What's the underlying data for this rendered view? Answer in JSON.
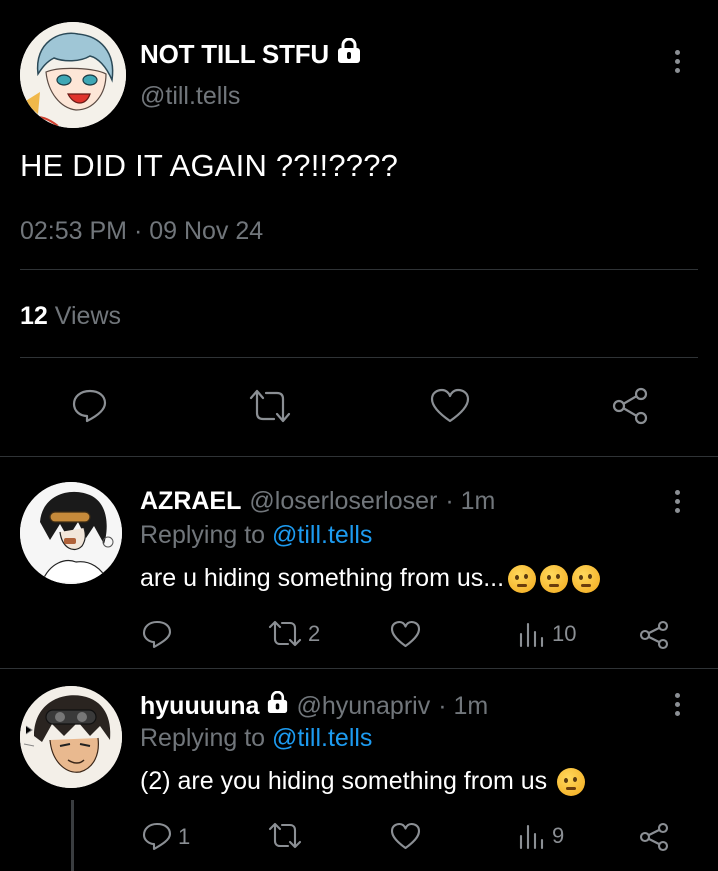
{
  "main_tweet": {
    "display_name": "NOT TILL STFU",
    "handle": "@till.tells",
    "text": "HE DID IT AGAIN ??!!????",
    "timestamp": "02:53 PM · 09 Nov 24",
    "views_count": "12",
    "views_label": "Views",
    "icons": [
      "lock-icon",
      "more-icon",
      "reply-icon",
      "retweet-icon",
      "like-icon",
      "share-icon"
    ]
  },
  "replies": [
    {
      "display_name": "AZRAEL",
      "handle": "@loserloserloser",
      "time": "· 1m",
      "replying_label": "Replying to",
      "replying_to": "@till.tells",
      "text": "are u hiding something from us...",
      "emoji_count": 3,
      "retweets": "2",
      "views": "10",
      "replies_count": "",
      "locked": false
    },
    {
      "display_name": "hyuuuuna",
      "handle": "@hyunapriv",
      "time": "· 1m",
      "replying_label": "Replying to",
      "replying_to": "@till.tells",
      "text": "(2) are you hiding something from us",
      "emoji_count": 1,
      "retweets": "",
      "views": "9",
      "replies_count": "1",
      "locked": true
    }
  ],
  "colors": {
    "background": "#000000",
    "text": "#e7e9ea",
    "muted": "#71767b",
    "link": "#1d9bf0",
    "divider": "#2f3336"
  }
}
